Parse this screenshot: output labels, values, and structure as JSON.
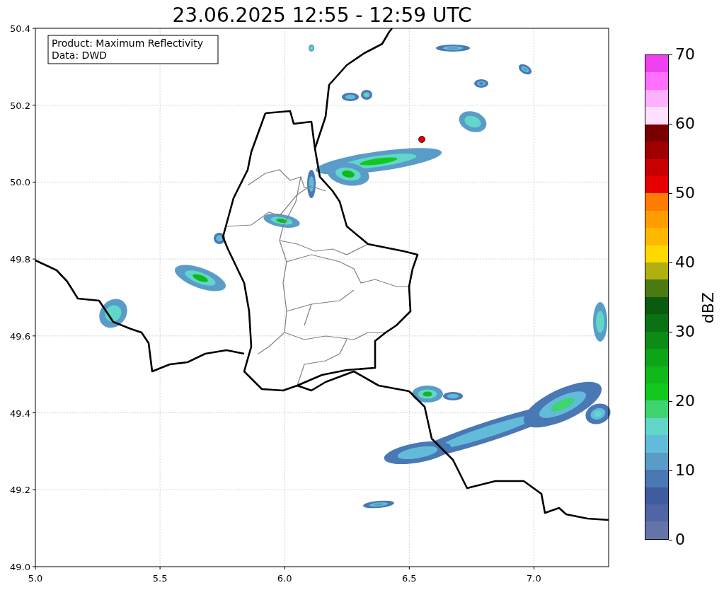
{
  "title": "23.06.2025 12:55 - 12:59 UTC",
  "info_box": {
    "lines": [
      "Product: Maximum Reflectivity",
      "Data: DWD"
    ]
  },
  "map": {
    "x_ticks": [
      "5.0",
      "5.5",
      "6.0",
      "6.5",
      "7.0"
    ],
    "y_ticks": [
      "50.4",
      "50.2",
      "50.0",
      "49.8",
      "49.6",
      "49.4",
      "49.2",
      "49.0"
    ]
  },
  "colorbar": {
    "label": "dBZ",
    "ticks": [
      "70",
      "60",
      "50",
      "40",
      "30",
      "20",
      "10",
      "0"
    ],
    "bins": [
      {
        "color": "#f040f0"
      },
      {
        "color": "#ff70ff"
      },
      {
        "color": "#ffb0ff"
      },
      {
        "color": "#ffe0ff"
      },
      {
        "color": "#7a0000"
      },
      {
        "color": "#a00000"
      },
      {
        "color": "#c80000"
      },
      {
        "color": "#e80000"
      },
      {
        "color": "#ff7c00"
      },
      {
        "color": "#ff9c00"
      },
      {
        "color": "#ffb800"
      },
      {
        "color": "#ffd800"
      },
      {
        "color": "#b0b010"
      },
      {
        "color": "#4a7a10"
      },
      {
        "color": "#0a5a10"
      },
      {
        "color": "#0a7212"
      },
      {
        "color": "#0c8c14"
      },
      {
        "color": "#0ea418"
      },
      {
        "color": "#10b81a"
      },
      {
        "color": "#12c81c"
      },
      {
        "color": "#3ed470"
      },
      {
        "color": "#62d6c8"
      },
      {
        "color": "#62bcd9"
      },
      {
        "color": "#5a9cc8"
      },
      {
        "color": "#4a78b4"
      },
      {
        "color": "#3f5ca0"
      },
      {
        "color": "#5164a3"
      },
      {
        "color": "#6474a8"
      }
    ]
  }
}
